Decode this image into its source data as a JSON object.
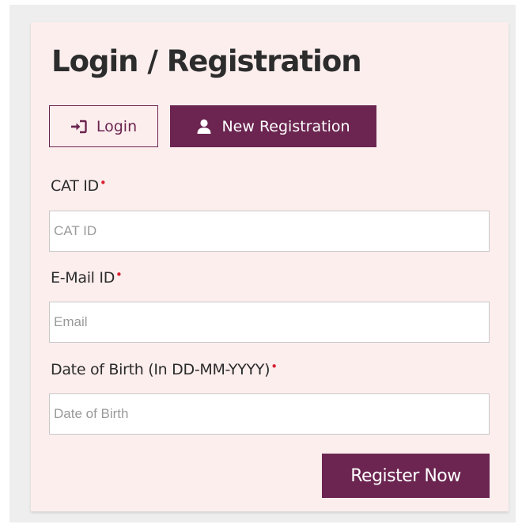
{
  "page": {
    "title": "Login / Registration"
  },
  "tabs": {
    "login_label": "Login",
    "login_icon": "sign-in-icon",
    "register_label": "New Registration",
    "register_icon": "user-icon",
    "active": "New Registration"
  },
  "form": {
    "fields": [
      {
        "label": "CAT ID",
        "placeholder": "CAT ID",
        "value": "",
        "required_marker": "•"
      },
      {
        "label": "E-Mail ID",
        "placeholder": "Email",
        "value": "",
        "required_marker": "•"
      },
      {
        "label": "Date of Birth (In DD-MM-YYYY)",
        "placeholder": "Date of Birth",
        "value": "",
        "required_marker": "•"
      }
    ],
    "submit_label": "Register Now"
  },
  "colors": {
    "brand": "#6b2550",
    "card_background": "#fdeeee",
    "required_marker": "#d8202f"
  }
}
